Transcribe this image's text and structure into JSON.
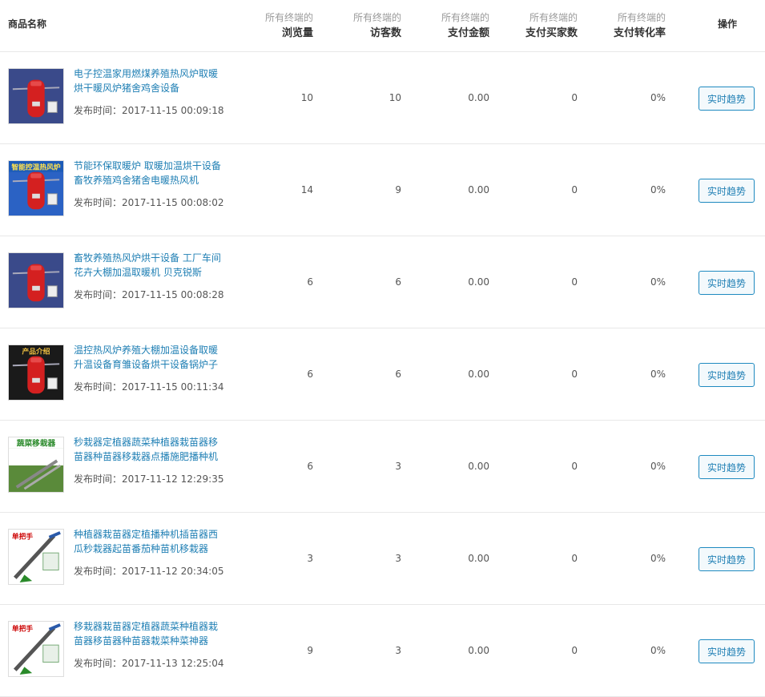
{
  "header": {
    "product_name": "商品名称",
    "metric_prefix": "所有终端的",
    "metrics": [
      "浏览量",
      "访客数",
      "支付金额",
      "支付买家数",
      "支付转化率"
    ],
    "operation": "操作"
  },
  "button_label": "实时趋势",
  "time_prefix": "发布时间：",
  "rows": [
    {
      "name_line1": "电子控温家用燃煤养殖热风炉取暖",
      "name_line2": "烘干暖风炉猪舍鸡舍设备",
      "time": "2017-11-15 00:09:18",
      "views": "10",
      "visitors": "10",
      "amount": "0.00",
      "buyers": "0",
      "rate": "0%",
      "thumb": "heater-red"
    },
    {
      "name_line1": "节能环保取暖炉 取暖加温烘干设备",
      "name_line2": "畜牧养殖鸡舍猪舍电暖热风机",
      "time": "2017-11-15 00:08:02",
      "views": "14",
      "visitors": "9",
      "amount": "0.00",
      "buyers": "0",
      "rate": "0%",
      "thumb": "heater-blue",
      "thumb_text": "智能控温热风炉"
    },
    {
      "name_line1": "畜牧养殖热风炉烘干设备 工厂车间",
      "name_line2": "花卉大棚加温取暖机 贝克锐斯",
      "time": "2017-11-15 00:08:28",
      "views": "6",
      "visitors": "6",
      "amount": "0.00",
      "buyers": "0",
      "rate": "0%",
      "thumb": "heater-red"
    },
    {
      "name_line1": "温控热风炉养殖大棚加温设备取暖",
      "name_line2": "升温设备育雏设备烘干设备锅炉子",
      "time": "2017-11-15 00:11:34",
      "views": "6",
      "visitors": "6",
      "amount": "0.00",
      "buyers": "0",
      "rate": "0%",
      "thumb": "heater-dark",
      "thumb_text": "产品介绍"
    },
    {
      "name_line1": "秒栽器定植器蔬菜种植器栽苗器移",
      "name_line2": "苗器种苗器移栽器点播施肥播种机",
      "time": "2017-11-12 12:29:35",
      "views": "6",
      "visitors": "3",
      "amount": "0.00",
      "buyers": "0",
      "rate": "0%",
      "thumb": "transplanter-green",
      "thumb_text": "蔬菜移栽器"
    },
    {
      "name_line1": "种植器栽苗器定植播种机插苗器西",
      "name_line2": "瓜秒栽器起苗番茄种苗机移栽器",
      "time": "2017-11-12 20:34:05",
      "views": "3",
      "visitors": "3",
      "amount": "0.00",
      "buyers": "0",
      "rate": "0%",
      "thumb": "transplanter-white",
      "thumb_text": "单把手"
    },
    {
      "name_line1": "移栽器栽苗器定植器蔬菜种植器栽",
      "name_line2": "苗器移苗器种苗器栽菜种菜神器",
      "time": "2017-11-13 12:25:04",
      "views": "9",
      "visitors": "3",
      "amount": "0.00",
      "buyers": "0",
      "rate": "0%",
      "thumb": "transplanter-white",
      "thumb_text": "单把手"
    }
  ],
  "colors": {
    "link": "#1f7fb4",
    "border": "#e8e8e8",
    "button_border": "#1f8ac0"
  }
}
